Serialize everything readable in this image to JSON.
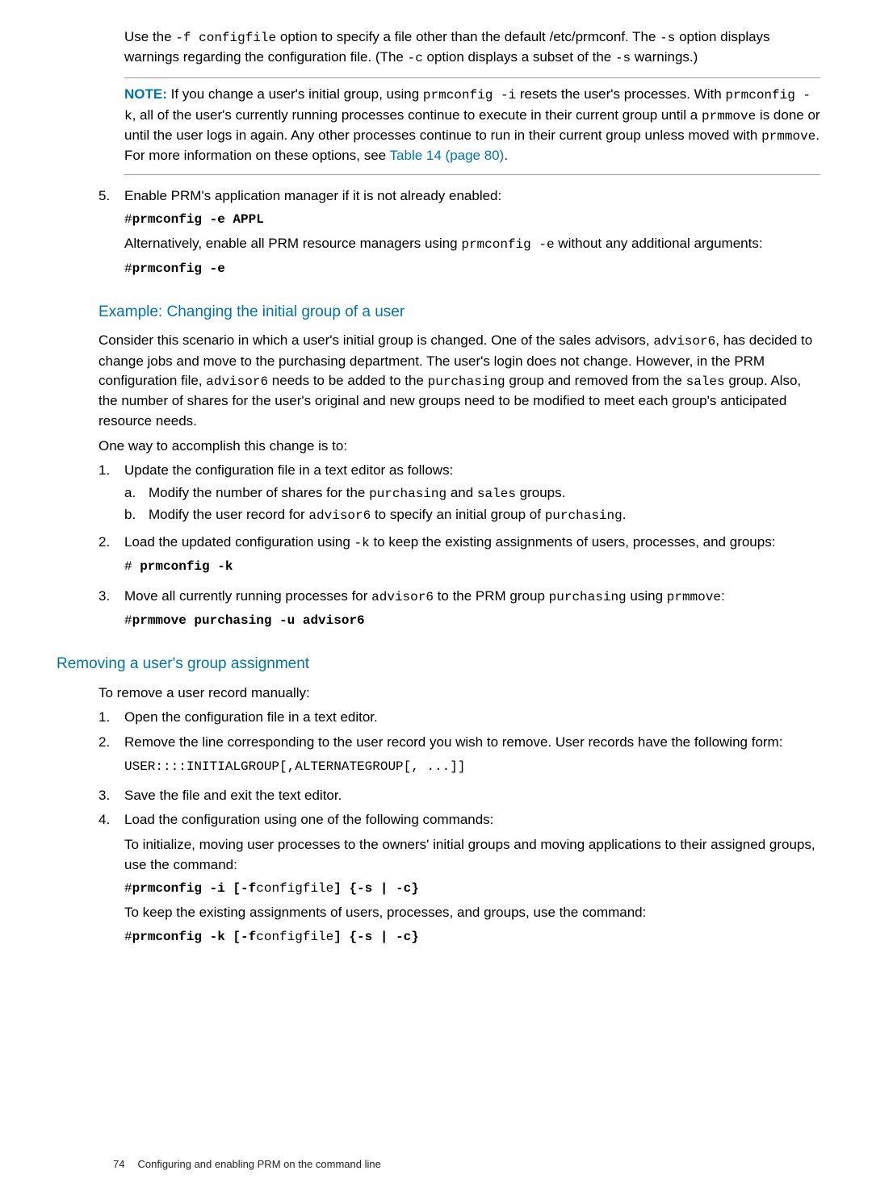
{
  "intro_p1_a": "Use the ",
  "intro_p1_code1": "-f configfile",
  "intro_p1_b": " option to specify a file other than the default /etc/prmconf. The ",
  "intro_p1_code2": "-s",
  "intro_p1_c": " option displays warnings regarding the configuration file. (The ",
  "intro_p1_code3": "-c",
  "intro_p1_d": " option displays a subset of the ",
  "intro_p1_code4": "-s",
  "intro_p1_e": " warnings.)",
  "note_label": "NOTE:",
  "note_a": "   If you change a user's initial group, using ",
  "note_c1": "prmconfig -i",
  "note_b": " resets the user's processes. With ",
  "note_c2": "prmconfig -k",
  "note_c": ", all of the user's currently running processes continue to execute in their current group until a ",
  "note_c3": "prmmove",
  "note_d": " is done or until the user logs in again. Any other processes continue to run in their current group unless moved with ",
  "note_c4": "prmmove",
  "note_e": ". For more information on these options, see ",
  "note_link": "Table 14 (page 80)",
  "note_f": ".",
  "s5_marker": "5.",
  "s5_text": "Enable PRM's application manager if it is not already enabled:",
  "s5_cmd1_a": "#",
  "s5_cmd1_b": "prmconfig -e APPL",
  "s5_p2_a": "Alternatively, enable all PRM resource managers using ",
  "s5_p2_code": "prmconfig -e",
  "s5_p2_b": " without any additional arguments:",
  "s5_cmd2_a": "#",
  "s5_cmd2_b": "prmconfig -e",
  "h_example": "Example: Changing the initial group of a user",
  "ex_p1_a": "Consider this scenario in which a user's initial group is changed. One of the sales advisors, ",
  "ex_p1_c1": "advisor6",
  "ex_p1_b": ", has decided to change jobs and move to the purchasing department. The user's login does not change. However, in the PRM configuration file, ",
  "ex_p1_c2": "advisor6",
  "ex_p1_c": " needs to be added to the ",
  "ex_p1_c3": "purchasing",
  "ex_p1_d": " group and removed from the ",
  "ex_p1_c4": "sales",
  "ex_p1_e": " group. Also, the number of shares for the user's original and new groups need to be modified to meet each group's anticipated resource needs.",
  "ex_p2": "One way to accomplish this change is to:",
  "ex_s1_marker": "1.",
  "ex_s1_text": "Update the configuration file in a text editor as follows:",
  "ex_s1a_marker": "a.",
  "ex_s1a_a": "Modify the number of shares for the ",
  "ex_s1a_c1": "purchasing",
  "ex_s1a_b": " and ",
  "ex_s1a_c2": "sales",
  "ex_s1a_c": " groups.",
  "ex_s1b_marker": "b.",
  "ex_s1b_a": "Modify the user record for ",
  "ex_s1b_c1": "advisor6",
  "ex_s1b_b": " to specify an initial group of ",
  "ex_s1b_c2": "purchasing",
  "ex_s1b_c": ".",
  "ex_s2_marker": "2.",
  "ex_s2_a": "Load the updated configuration using ",
  "ex_s2_c1": "-k",
  "ex_s2_b": " to keep the existing assignments of users, processes, and groups:",
  "ex_s2_cmd_a": "# ",
  "ex_s2_cmd_b": "prmconfig -k",
  "ex_s3_marker": "3.",
  "ex_s3_a": "Move all currently running processes for ",
  "ex_s3_c1": "advisor6",
  "ex_s3_b": " to the PRM group ",
  "ex_s3_c2": "purchasing",
  "ex_s3_c": " using ",
  "ex_s3_c3": "prmmove",
  "ex_s3_d": ":",
  "ex_s3_cmd_a": "#",
  "ex_s3_cmd_b": "prmmove purchasing -u advisor6",
  "h_remove": "Removing a user's group assignment",
  "rm_p1": "To remove a user record manually:",
  "rm_s1_marker": "1.",
  "rm_s1_text": "Open the configuration file in a text editor.",
  "rm_s2_marker": "2.",
  "rm_s2_text": "Remove the line corresponding to the user record you wish to remove. User records have the following form:",
  "rm_s2_code": "USER::::INITIALGROUP[,ALTERNATEGROUP[, ...]]",
  "rm_s3_marker": "3.",
  "rm_s3_text": "Save the file and exit the text editor.",
  "rm_s4_marker": "4.",
  "rm_s4_text": "Load the configuration using one of the following commands:",
  "rm_s4_p1": "To initialize, moving user processes to the owners' initial groups and moving applications to their assigned groups, use the command:",
  "rm_s4_cmd1_a": "#",
  "rm_s4_cmd1_b": "prmconfig -i [-f",
  "rm_s4_cmd1_c": "configfile",
  "rm_s4_cmd1_d": "] {-s | -c}",
  "rm_s4_p2": "To keep the existing assignments of users, processes, and groups, use the command:",
  "rm_s4_cmd2_a": "#",
  "rm_s4_cmd2_b": "prmconfig -k [-f",
  "rm_s4_cmd2_c": "configfile",
  "rm_s4_cmd2_d": "] {-s | -c}",
  "footer_page": "74",
  "footer_text": "Configuring and enabling PRM on the command line"
}
